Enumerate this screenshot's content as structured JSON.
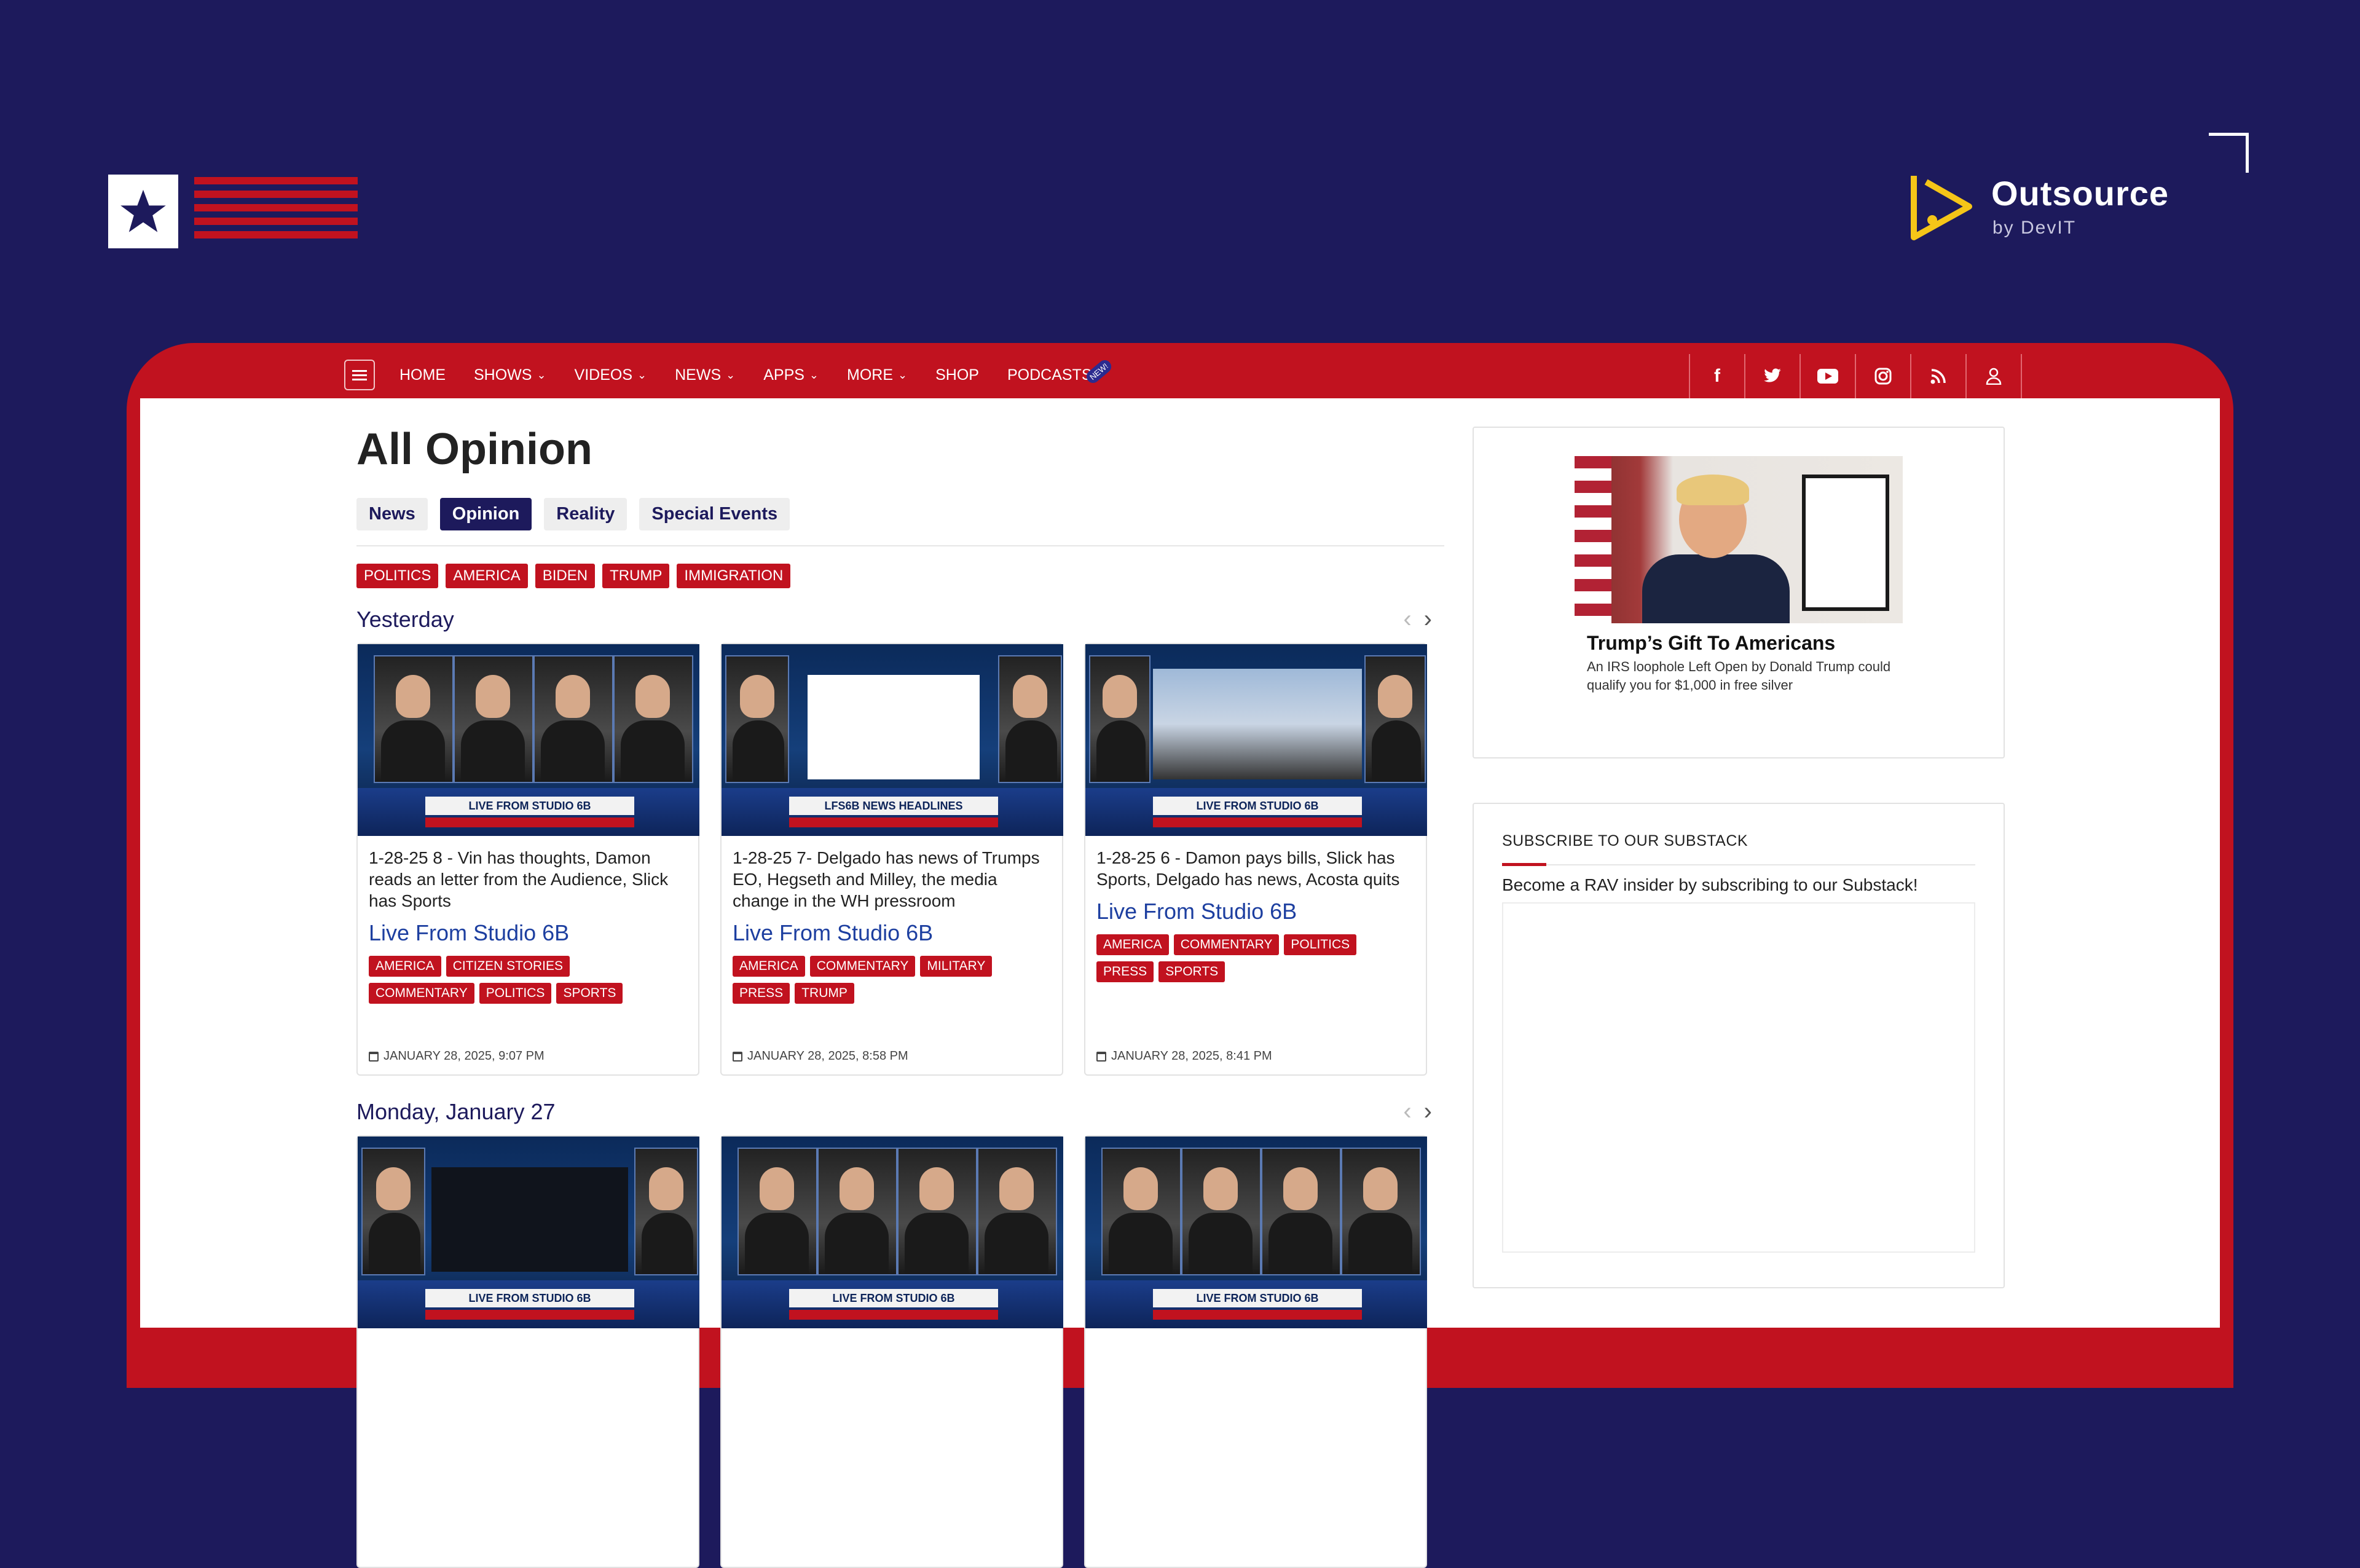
{
  "branding": {
    "right_logo_title": "Outsource",
    "right_logo_subtitle": "by DevIT"
  },
  "nav": {
    "items": [
      {
        "label": "HOME",
        "dropdown": false
      },
      {
        "label": "SHOWS",
        "dropdown": true
      },
      {
        "label": "VIDEOS",
        "dropdown": true
      },
      {
        "label": "NEWS",
        "dropdown": true
      },
      {
        "label": "APPS",
        "dropdown": true
      },
      {
        "label": "MORE",
        "dropdown": true
      },
      {
        "label": "SHOP",
        "dropdown": false
      },
      {
        "label": "PODCASTS",
        "dropdown": false,
        "badge": "NEW!"
      }
    ],
    "socials": [
      "facebook-icon",
      "twitter-icon",
      "youtube-icon",
      "instagram-icon",
      "rss-icon",
      "user-icon"
    ]
  },
  "page": {
    "title": "All Opinion",
    "tabs": [
      {
        "label": "News",
        "active": false
      },
      {
        "label": "Opinion",
        "active": true
      },
      {
        "label": "Reality",
        "active": false
      },
      {
        "label": "Special Events",
        "active": false
      }
    ],
    "filter_tags": [
      "POLITICS",
      "AMERICA",
      "BIDEN",
      "TRUMP",
      "IMMIGRATION"
    ]
  },
  "sections": [
    {
      "title": "Yesterday",
      "cards": [
        {
          "title": "1-28-25 8 - Vin has thoughts, Damon reads an letter from the Audience, Slick has Sports",
          "show": "Live From Studio 6B",
          "tags": [
            "AMERICA",
            "CITIZEN STORIES",
            "COMMENTARY",
            "POLITICS",
            "SPORTS"
          ],
          "date": "JANUARY 28, 2025, 9:07 PM",
          "lower_third": "LIVE FROM STUDIO 6B"
        },
        {
          "title": "1-28-25 7- Delgado has news of Trumps EO, Hegseth and Milley, the media change in the WH pressroom",
          "show": "Live From Studio 6B",
          "tags": [
            "AMERICA",
            "COMMENTARY",
            "MILITARY",
            "PRESS",
            "TRUMP"
          ],
          "date": "JANUARY 28, 2025, 8:58 PM",
          "lower_third": "LFS6B NEWS HEADLINES"
        },
        {
          "title": "1-28-25 6 - Damon pays bills, Slick has Sports, Delgado has news, Acosta quits",
          "show": "Live From Studio 6B",
          "tags": [
            "AMERICA",
            "COMMENTARY",
            "POLITICS",
            "PRESS",
            "SPORTS"
          ],
          "date": "JANUARY 28, 2025, 8:41 PM",
          "lower_third": "LIVE FROM STUDIO 6B"
        }
      ]
    },
    {
      "title": "Monday, January 27",
      "cards": [
        {
          "lower_third": "LIVE FROM STUDIO 6B"
        },
        {
          "lower_third": "LIVE FROM STUDIO 6B"
        },
        {
          "lower_third": "LIVE FROM STUDIO 6B"
        }
      ]
    }
  ],
  "sidebar": {
    "ad": {
      "title": "Trump’s Gift To Americans",
      "description": "An IRS loophole Left Open by Donald Trump could qualify you for $1,000 in free silver"
    },
    "subscribe": {
      "title": "SUBSCRIBE TO OUR SUBSTACK",
      "description": "Become a RAV insider by subscribing to our Substack!"
    }
  },
  "colors": {
    "background": "#1d1a5c",
    "accent_red": "#c1121f",
    "link_blue": "#1d3fa0",
    "logo_yellow": "#f5c518"
  }
}
